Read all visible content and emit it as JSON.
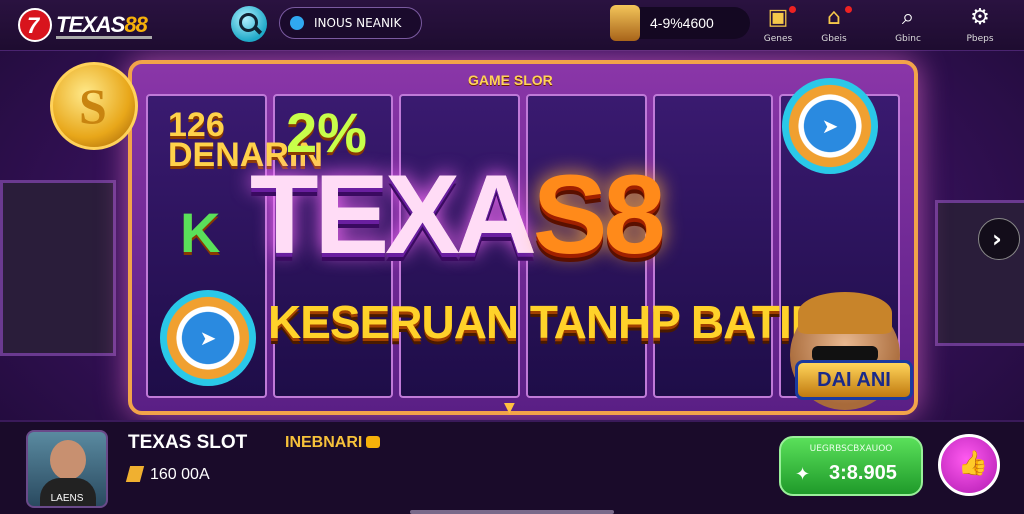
{
  "header": {
    "brand_prefix": "7",
    "brand_main": "TEXAS",
    "brand_num": "88",
    "search_pill_text": "INOUS NEANIK",
    "coin_balance": "4-9%4600",
    "nav": [
      {
        "label": "Genes",
        "icon": "▣"
      },
      {
        "label": "Gbeis",
        "icon": "⌂"
      },
      {
        "label": "Gbinc",
        "icon": "⌕"
      },
      {
        "label": "Pbeps",
        "icon": "⚙"
      }
    ]
  },
  "banner": {
    "game_slot_label": "GAME SLOR",
    "title_part1": "TEXA",
    "title_part2": "S8",
    "title_part3": "8",
    "subtitle": "KESERUAN TANHP BATIRS",
    "coin_symbol": "S",
    "left_badge": "126\nDENARIN",
    "symbol_2": "2%",
    "symbol_k": "K",
    "plate_label": "DAI ANI",
    "next_arrow": "›",
    "caret": "▼"
  },
  "footer": {
    "avatar_label": "LAENS",
    "game_name": "TEXAS SLOT",
    "tag_text": "INEBNARI",
    "balance": "160 00A",
    "play_small_text": "UEGRBSCBXAUOO",
    "play_value": "3:8.905",
    "play_icon": "✦",
    "like_icon": "👍"
  },
  "colors": {
    "accent_gold": "#f6b10a",
    "brand_red": "#d8141d",
    "play_green": "#2fb83a",
    "like_magenta": "#e040e0"
  }
}
